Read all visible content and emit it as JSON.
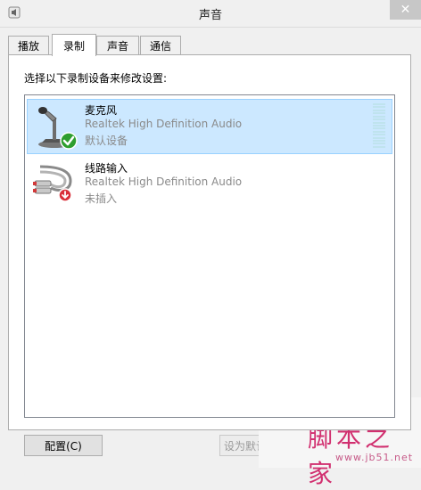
{
  "window": {
    "title": "声音",
    "close_glyph": "✕"
  },
  "tabs": [
    {
      "label": "播放",
      "active": false
    },
    {
      "label": "录制",
      "active": true
    },
    {
      "label": "声音",
      "active": false
    },
    {
      "label": "通信",
      "active": false
    }
  ],
  "panel": {
    "instruction": "选择以下录制设备来修改设置:"
  },
  "devices": [
    {
      "name": "麦克风",
      "driver": "Realtek High Definition Audio",
      "status": "默认设备",
      "icon": "microphone-icon",
      "badge": "default-check-badge",
      "selected": true
    },
    {
      "name": "线路输入",
      "driver": "Realtek High Definition Audio",
      "status": "未插入",
      "icon": "line-in-cable-icon",
      "badge": "unplugged-badge",
      "selected": false
    }
  ],
  "buttons": {
    "configure": "配置(C)",
    "set_default": "设为默认"
  },
  "watermark": {
    "brand": "脚本之家",
    "url": "www.jb51.net"
  },
  "colors": {
    "selection_bg": "#cce8ff",
    "selection_border": "#99d1ff",
    "default_check": "#2e9e2e",
    "unplugged_badge": "#d9303a",
    "watermark": "#d12f6f"
  }
}
